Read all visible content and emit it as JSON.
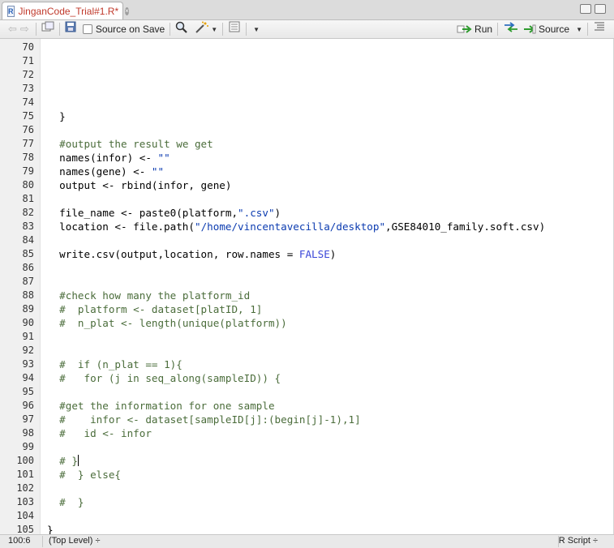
{
  "tab": {
    "title": "JinganCode_Trial#1.R*",
    "icon": "r-file-icon"
  },
  "toolbar": {
    "source_on_save_label": "Source on Save",
    "run_label": "Run",
    "source_label": "Source"
  },
  "editor": {
    "lines": [
      {
        "n": "70",
        "t": ""
      },
      {
        "n": "71",
        "t": ""
      },
      {
        "n": "72",
        "t": ""
      },
      {
        "n": "73",
        "t": ""
      },
      {
        "n": "74",
        "t": ""
      },
      {
        "n": "75",
        "t": "  }"
      },
      {
        "n": "76",
        "t": ""
      },
      {
        "n": "77",
        "t": "  #output the result we get"
      },
      {
        "n": "78",
        "t": "  names(infor) <- \"\""
      },
      {
        "n": "79",
        "t": "  names(gene) <- \"\""
      },
      {
        "n": "80",
        "t": "  output <- rbind(infor, gene)"
      },
      {
        "n": "81",
        "t": ""
      },
      {
        "n": "82",
        "t": "  file_name <- paste0(platform,\".csv\")"
      },
      {
        "n": "83",
        "t": "  location <- file.path(\"/home/vincentavecilla/desktop\",GSE84010_family.soft.csv)"
      },
      {
        "n": "84",
        "t": ""
      },
      {
        "n": "85",
        "t": "  write.csv(output,location, row.names = FALSE)"
      },
      {
        "n": "86",
        "t": ""
      },
      {
        "n": "87",
        "t": ""
      },
      {
        "n": "88",
        "t": "  #check how many the platform_id"
      },
      {
        "n": "89",
        "t": "  #  platform <- dataset[platID, 1]"
      },
      {
        "n": "90",
        "t": "  #  n_plat <- length(unique(platform))"
      },
      {
        "n": "91",
        "t": ""
      },
      {
        "n": "92",
        "t": ""
      },
      {
        "n": "93",
        "t": "  #  if (n_plat == 1){"
      },
      {
        "n": "94",
        "t": "  #   for (j in seq_along(sampleID)) {"
      },
      {
        "n": "95",
        "t": ""
      },
      {
        "n": "96",
        "t": "  #get the information for one sample"
      },
      {
        "n": "97",
        "t": "  #    infor <- dataset[sampleID[j]:(begin[j]-1),1]"
      },
      {
        "n": "98",
        "t": "  #   id <- infor"
      },
      {
        "n": "99",
        "t": ""
      },
      {
        "n": "100",
        "t": "  # }"
      },
      {
        "n": "101",
        "t": "  #  } else{"
      },
      {
        "n": "102",
        "t": ""
      },
      {
        "n": "103",
        "t": "  #  }"
      },
      {
        "n": "104",
        "t": ""
      },
      {
        "n": "105",
        "t": "}"
      }
    ]
  },
  "status": {
    "position": "100:6",
    "scope": "(Top Level) ÷",
    "file_type": "R Script ÷"
  }
}
